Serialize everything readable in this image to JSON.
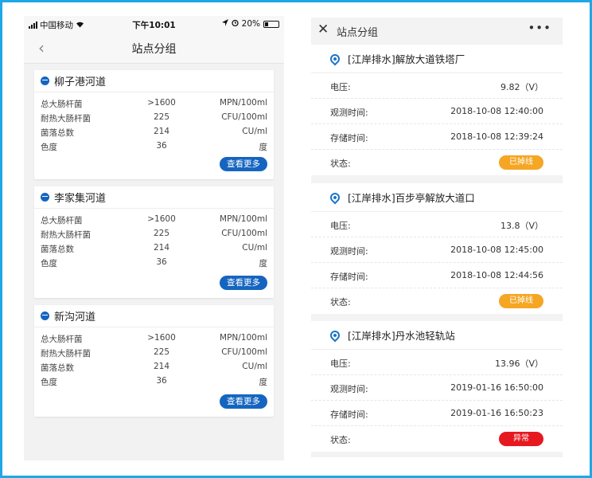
{
  "left": {
    "status_bar": {
      "carrier": "中国移动",
      "time": "下午10:01",
      "battery": "20%"
    },
    "nav": {
      "back": "‹",
      "title": "站点分组"
    },
    "cards": [
      {
        "title": "柳子港河道",
        "rows": [
          {
            "k": "总大肠杆菌",
            "v": ">1600",
            "u": "MPN/100ml"
          },
          {
            "k": "耐热大肠杆菌",
            "v": "225",
            "u": "CFU/100ml"
          },
          {
            "k": "菌落总数",
            "v": "214",
            "u": "CU/ml"
          },
          {
            "k": "色度",
            "v": "36",
            "u": "度"
          }
        ],
        "button": "查看更多"
      },
      {
        "title": "李家集河道",
        "rows": [
          {
            "k": "总大肠杆菌",
            "v": ">1600",
            "u": "MPN/100ml"
          },
          {
            "k": "耐热大肠杆菌",
            "v": "225",
            "u": "CFU/100ml"
          },
          {
            "k": "菌落总数",
            "v": "214",
            "u": "CU/ml"
          },
          {
            "k": "色度",
            "v": "36",
            "u": "度"
          }
        ],
        "button": "查看更多"
      },
      {
        "title": "新沟河道",
        "rows": [
          {
            "k": "总大肠杆菌",
            "v": ">1600",
            "u": "MPN/100ml"
          },
          {
            "k": "耐热大肠杆菌",
            "v": "225",
            "u": "CFU/100ml"
          },
          {
            "k": "菌落总数",
            "v": "214",
            "u": "CU/ml"
          },
          {
            "k": "色度",
            "v": "36",
            "u": "度"
          }
        ],
        "button": "查看更多"
      }
    ]
  },
  "right": {
    "nav": {
      "close": "✕",
      "title": "站点分组",
      "more": "•••"
    },
    "stations": [
      {
        "title": "[江岸排水]解放大道铁塔厂",
        "rows": [
          {
            "k": "电压:",
            "v": "9.82（V）"
          },
          {
            "k": "观测时间:",
            "v": "2018-10-08 12:40:00"
          },
          {
            "k": "存储时间:",
            "v": "2018-10-08 12:39:24"
          }
        ],
        "status_label": "状态:",
        "status": "已掉线",
        "status_color": "#f5a623"
      },
      {
        "title": "[江岸排水]百步亭解放大道口",
        "rows": [
          {
            "k": "电压:",
            "v": "13.8（V）"
          },
          {
            "k": "观测时间:",
            "v": "2018-10-08 12:45:00"
          },
          {
            "k": "存储时间:",
            "v": "2018-10-08 12:44:56"
          }
        ],
        "status_label": "状态:",
        "status": "已掉线",
        "status_color": "#f5a623"
      },
      {
        "title": "[江岸排水]丹水池轻轨站",
        "rows": [
          {
            "k": "电压:",
            "v": "13.96（V）"
          },
          {
            "k": "观测时间:",
            "v": "2019-01-16 16:50:00"
          },
          {
            "k": "存储时间:",
            "v": "2019-01-16 16:50:23"
          }
        ],
        "status_label": "状态:",
        "status": "异常",
        "status_color": "#e5191f"
      }
    ]
  },
  "colors": {
    "frame": "#1fa7e6",
    "primary": "#1565c0",
    "offline": "#f5a623",
    "error": "#e5191f"
  }
}
